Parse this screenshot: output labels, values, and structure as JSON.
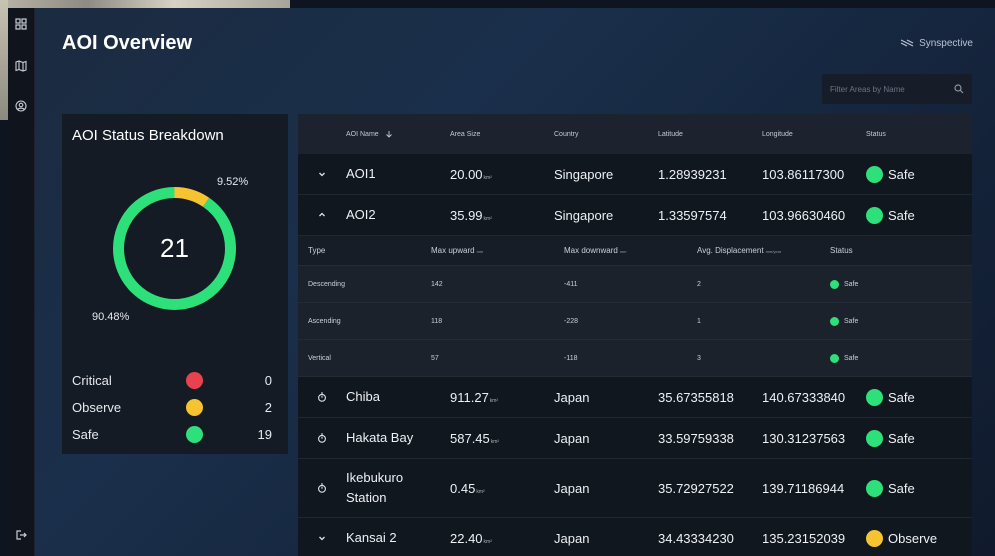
{
  "app": {
    "title": "AOI Overview",
    "brand": "Synspective"
  },
  "sidebar": {
    "items": [
      {
        "icon": "dashboard-icon"
      },
      {
        "icon": "map-icon"
      },
      {
        "icon": "user-circle-icon"
      },
      {
        "icon": "logout-icon"
      }
    ]
  },
  "filter": {
    "placeholder": "Filter Areas by Name"
  },
  "status_card": {
    "title": "AOI Status Breakdown",
    "total": "21",
    "pct_observe": "9.52%",
    "pct_safe": "90.48%",
    "legend": [
      {
        "label": "Critical",
        "count": "0",
        "color": "#e8424f"
      },
      {
        "label": "Observe",
        "count": "2",
        "color": "#f6c431"
      },
      {
        "label": "Safe",
        "count": "19",
        "color": "#2ee07a"
      }
    ],
    "donut": {
      "critical": 0,
      "observe": 2,
      "safe": 19
    }
  },
  "colors": {
    "safe": "#2ee07a",
    "observe": "#f6c431",
    "critical": "#e8424f"
  },
  "table": {
    "headers": {
      "name": "AOI Name",
      "area": "Area Size",
      "country": "Country",
      "lat": "Latitude",
      "lon": "Longitude",
      "status": "Status"
    },
    "area_unit": "km²",
    "rows": [
      {
        "name": "AOI1",
        "area": "20.00",
        "country": "Singapore",
        "lat": "1.28939231",
        "lon": "103.86117300",
        "status": "Safe",
        "icon": "chevron-down-icon"
      },
      {
        "name": "AOI2",
        "area": "35.99",
        "country": "Singapore",
        "lat": "1.33597574",
        "lon": "103.96630460",
        "status": "Safe",
        "icon": "chevron-up-icon"
      },
      {
        "name": "Chiba",
        "area": "911.27",
        "country": "Japan",
        "lat": "35.67355818",
        "lon": "140.67333840",
        "status": "Safe",
        "icon": "stopwatch-icon"
      },
      {
        "name": "Hakata Bay",
        "area": "587.45",
        "country": "Japan",
        "lat": "33.59759338",
        "lon": "130.31237563",
        "status": "Safe",
        "icon": "stopwatch-icon"
      },
      {
        "name": "Ikebukuro Station",
        "area": "0.45",
        "country": "Japan",
        "lat": "35.72927522",
        "lon": "139.71186944",
        "status": "Safe",
        "icon": "stopwatch-icon"
      },
      {
        "name": "Kansai 2",
        "area": "22.40",
        "country": "Japan",
        "lat": "34.43334230",
        "lon": "135.23152039",
        "status": "Observe",
        "icon": "chevron-down-icon"
      }
    ],
    "detail": {
      "headers": {
        "type": "Type",
        "up": "Max upward",
        "up_unit": "mm",
        "down": "Max downward",
        "down_unit": "mm",
        "avg": "Avg. Displacement",
        "avg_unit": "mm/year",
        "status": "Status"
      },
      "rows": [
        {
          "type": "Descending",
          "up": "142",
          "down": "-411",
          "avg": "2",
          "status": "Safe"
        },
        {
          "type": "Ascending",
          "up": "118",
          "down": "-228",
          "avg": "1",
          "status": "Safe"
        },
        {
          "type": "Vertical",
          "up": "57",
          "down": "-118",
          "avg": "3",
          "status": "Safe"
        }
      ]
    }
  }
}
